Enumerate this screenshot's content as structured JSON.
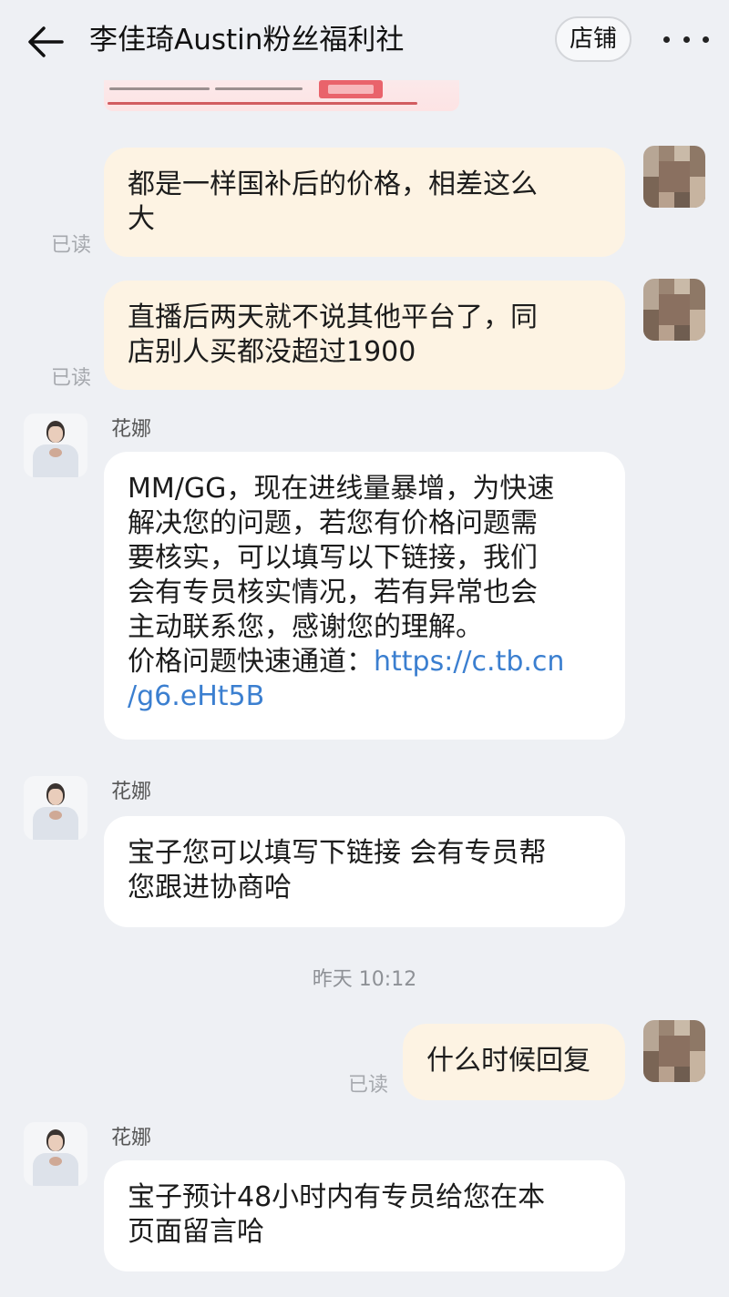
{
  "header": {
    "title": "李佳琦Austin粉丝福利社",
    "shop_label": "店铺"
  },
  "icons": {
    "back": "arrow-left-icon",
    "more": "more-dots-icon"
  },
  "messages": {
    "m1": {
      "line1": "都是一样国补后的价格，相差这么",
      "line2": "大",
      "status": "已读"
    },
    "m2": {
      "line1": "直播后两天就不说其他平台了，同",
      "line2": "店别人买都没超过1900",
      "status": "已读"
    },
    "m3": {
      "sender": "花娜",
      "line1": "MM/GG，现在进线量暴增，为快速",
      "line2": "解决您的问题，若您有价格问题需",
      "line3": "要核实，可以填写以下链接，我们",
      "line4": "会有专员核实情况，若有异常也会",
      "line5": "主动联系您，感谢您的理解。",
      "line6_prefix": "价格问题快速通道：",
      "link_part1": "https://c.tb.cn",
      "link_part2": "/g6.eHt5B"
    },
    "m4": {
      "sender": "花娜",
      "line1": "宝子您可以填写下链接 会有专员帮",
      "line2": "您跟进协商哈"
    },
    "timestamp": "昨天  10:12",
    "m5": {
      "line1": "什么时候回复",
      "status": "已读"
    },
    "m6": {
      "sender": "花娜",
      "line1": "宝子预计48小时内有专员给您在本",
      "line2": "页面留言哈"
    }
  },
  "colors": {
    "background": "#eef0f4",
    "sent_bubble": "#fdf3e3",
    "received_bubble": "#ffffff",
    "link": "#3b7fd0"
  }
}
